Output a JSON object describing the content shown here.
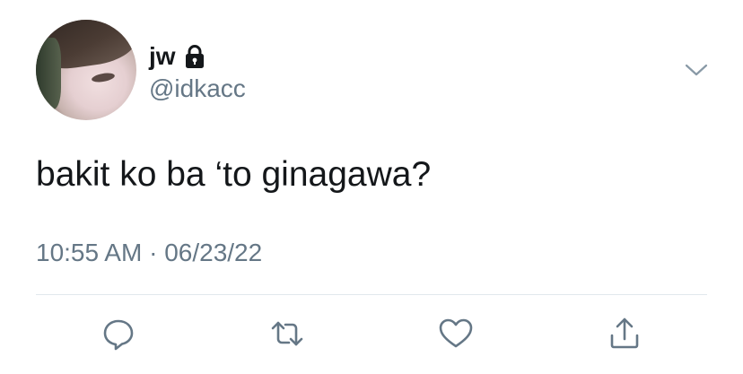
{
  "tweet": {
    "display_name": "jw",
    "handle": "@idkacc",
    "text": "bakit ko ba ‘to ginagawa?",
    "time": "10:55 AM",
    "separator": "·",
    "date": "06/23/22"
  },
  "icons": {
    "protected": "lock-icon",
    "menu": "chevron-down-icon",
    "reply": "reply-icon",
    "retweet": "retweet-icon",
    "like": "heart-icon",
    "share": "share-icon"
  },
  "colors": {
    "text": "#14171a",
    "secondary": "#657786",
    "divider": "#e1e8ed",
    "background": "#ffffff"
  }
}
